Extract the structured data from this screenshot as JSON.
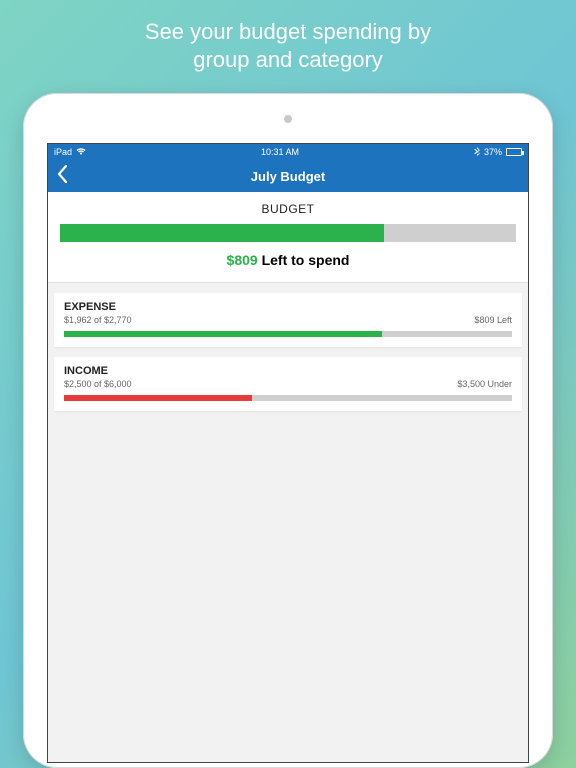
{
  "promo": {
    "line1": "See your budget spending by",
    "line2": "group and category"
  },
  "statusbar": {
    "device": "iPad",
    "time": "10:31 AM",
    "battery_pct": "37%"
  },
  "nav": {
    "title": "July Budget"
  },
  "budget": {
    "label": "BUDGET",
    "fill_pct": 71,
    "amount": "$809",
    "left_text": "Left to spend"
  },
  "groups": [
    {
      "title": "EXPENSE",
      "sub": "$1,962 of $2,770",
      "right": "$809 Left",
      "fill_pct": 71,
      "color": "green"
    },
    {
      "title": "INCOME",
      "sub": "$2,500 of $6,000",
      "right": "$3,500 Under",
      "fill_pct": 42,
      "color": "red"
    }
  ]
}
